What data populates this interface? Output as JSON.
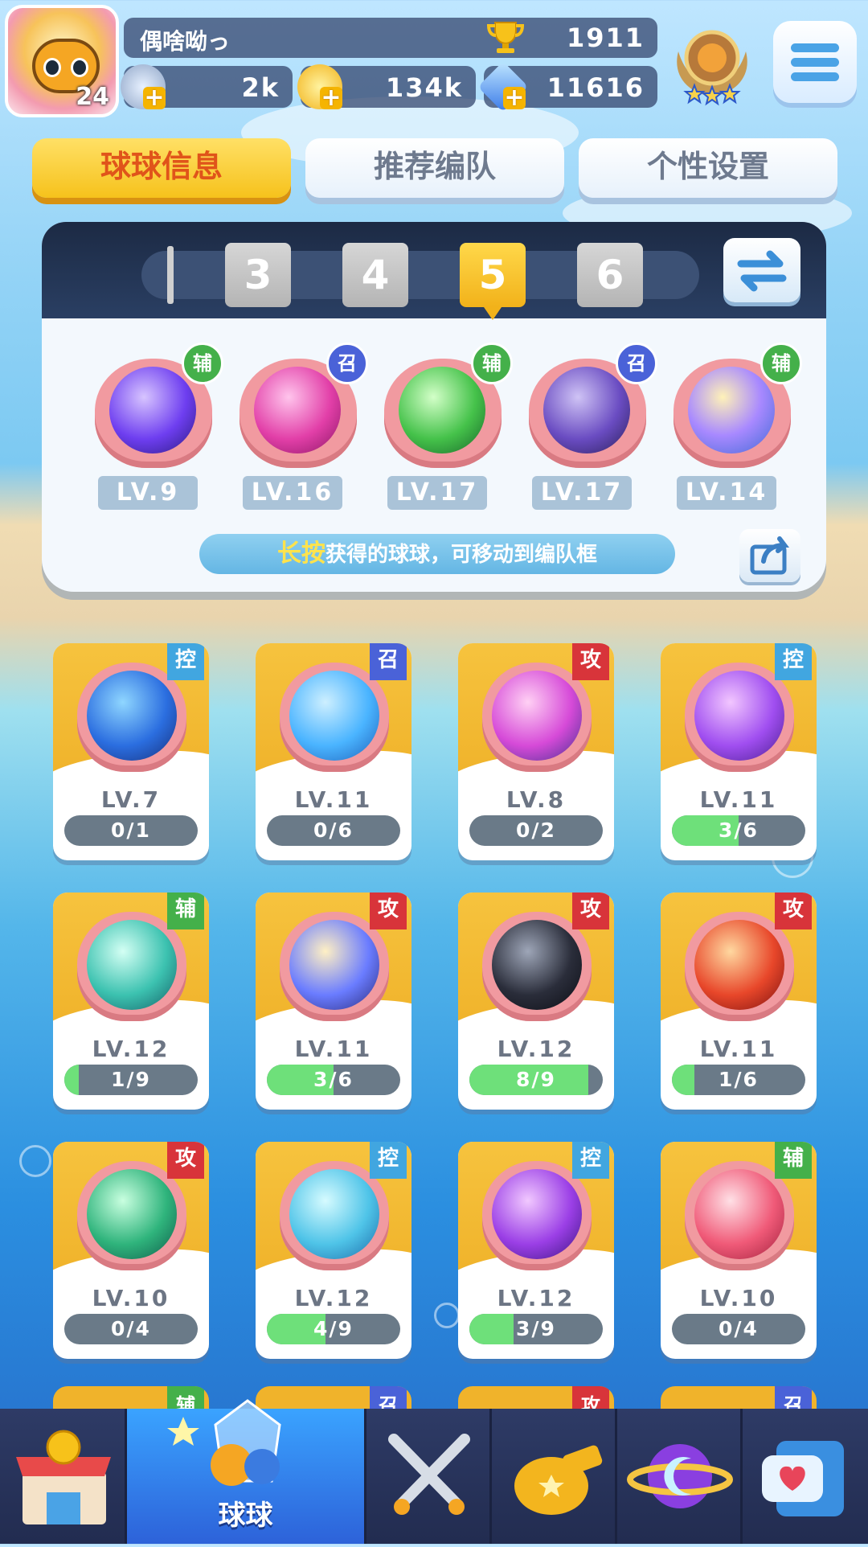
{
  "player": {
    "name": "偶啥呦っ",
    "level": "24",
    "trophies": "1911"
  },
  "resources": {
    "stars": "2k",
    "coins": "134k",
    "gems": "11616"
  },
  "tabs": [
    {
      "label": "球球信息",
      "active": true
    },
    {
      "label": "推荐编队",
      "active": false
    },
    {
      "label": "个性设置",
      "active": false
    }
  ],
  "deck": {
    "numbers": [
      "3",
      "4",
      "5",
      "6"
    ],
    "selected": "5",
    "slots": [
      {
        "level": "LV.9",
        "tag": "辅",
        "icon": "lightning-icon"
      },
      {
        "level": "LV.16",
        "tag": "召",
        "icon": "dagger-icon"
      },
      {
        "level": "LV.17",
        "tag": "辅",
        "icon": "star-arrow-icon"
      },
      {
        "level": "LV.17",
        "tag": "召",
        "icon": "ghost-icon"
      },
      {
        "level": "LV.14",
        "tag": "辅",
        "icon": "crowd-icon"
      }
    ],
    "hint_highlight": "长按",
    "hint_text": "获得的球球，可移动到编队框"
  },
  "cards": [
    {
      "tag": "控",
      "level": "LV.7",
      "progress": "0/1",
      "ratio": 0,
      "icon": "hero-silhouette-icon"
    },
    {
      "tag": "召",
      "level": "LV.11",
      "progress": "0/6",
      "ratio": 0,
      "icon": "potion-bottle-icon"
    },
    {
      "tag": "攻",
      "level": "LV.8",
      "progress": "0/2",
      "ratio": 0,
      "icon": "crystal-burst-icon"
    },
    {
      "tag": "控",
      "level": "LV.11",
      "progress": "3/6",
      "ratio": 0.5,
      "icon": "spellbook-icon"
    },
    {
      "tag": "辅",
      "level": "LV.12",
      "progress": "1/9",
      "ratio": 0.11,
      "icon": "dragon-icon"
    },
    {
      "tag": "攻",
      "level": "LV.11",
      "progress": "3/6",
      "ratio": 0.5,
      "icon": "prism-icon"
    },
    {
      "tag": "攻",
      "level": "LV.12",
      "progress": "8/9",
      "ratio": 0.89,
      "icon": "venom-icon"
    },
    {
      "tag": "攻",
      "level": "LV.11",
      "progress": "1/6",
      "ratio": 0.17,
      "icon": "fire-dragon-icon"
    },
    {
      "tag": "攻",
      "level": "LV.10",
      "progress": "0/4",
      "ratio": 0,
      "icon": "trident-icon"
    },
    {
      "tag": "控",
      "level": "LV.12",
      "progress": "4/9",
      "ratio": 0.44,
      "icon": "whirlwind-icon"
    },
    {
      "tag": "控",
      "level": "LV.12",
      "progress": "3/9",
      "ratio": 0.33,
      "icon": "hook-icon"
    },
    {
      "tag": "辅",
      "level": "LV.10",
      "progress": "0/4",
      "ratio": 0,
      "icon": "gift-icon"
    }
  ],
  "peek_tags": [
    "辅",
    "召",
    "攻",
    "召"
  ],
  "nav": [
    {
      "label": "",
      "icon": "shop-icon"
    },
    {
      "label": "球球",
      "icon": "balls-icon",
      "active": true
    },
    {
      "label": "",
      "icon": "crossed-swords-icon"
    },
    {
      "label": "",
      "icon": "whistle-icon"
    },
    {
      "label": "",
      "icon": "planet-icon"
    },
    {
      "label": "",
      "icon": "heart-chat-icon"
    }
  ],
  "colors": {
    "accent": "#f6c21c",
    "active_tab_text": "#e0541a",
    "tag_control": "#41a6e0",
    "tag_attack": "#d8343a",
    "tag_support": "#44b04a",
    "tag_summon": "#4a62d8"
  }
}
